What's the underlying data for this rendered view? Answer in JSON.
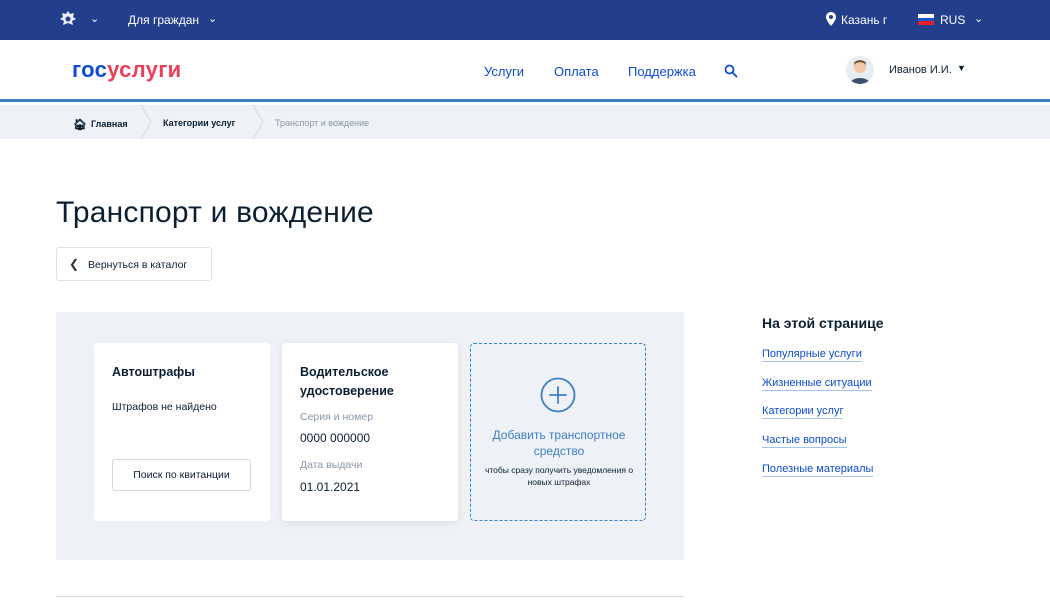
{
  "topbar": {
    "audience_label": "Для граждан",
    "city": "Казань г",
    "language": "RUS",
    "colors": {
      "background": "#233f8c",
      "text": "#ffffff"
    },
    "icons": [
      "emblem-icon",
      "chevron-down-icon",
      "location-pin-icon",
      "flag-ru-icon"
    ]
  },
  "header": {
    "logo_part1": "гос",
    "logo_part2": "услуги",
    "nav": [
      {
        "label": "Услуги"
      },
      {
        "label": "Оплата"
      },
      {
        "label": "Поддержка"
      }
    ],
    "user_name": "Иванов И.И.",
    "colors": {
      "logo_blue": "#0d4cd3",
      "logo_red": "#ee3f58",
      "underline": "#3e7ec4"
    }
  },
  "breadcrumbs": {
    "home": "Главная",
    "category": "Категории услуг",
    "current": "Транспорт и вождение"
  },
  "page": {
    "title": "Транспорт и вождение",
    "back_label": "Вернуться в каталог"
  },
  "cards": {
    "fines": {
      "title": "Автоштрафы",
      "status": "Штрафов не найдено",
      "button": "Поиск по квитанции"
    },
    "license": {
      "title": "Водительское удостоверение",
      "number_label": "Серия и номер",
      "number_value": "0000 000000",
      "issue_label": "Дата выдачи",
      "issue_value": "01.01.2021"
    },
    "add_vehicle": {
      "title": "Добавить транспортное средство",
      "subtitle": "чтобы сразу получить уведомления о новых штрафах"
    }
  },
  "sidebar": {
    "title": "На этой странице",
    "links": [
      {
        "label": "Популярные услуги"
      },
      {
        "label": "Жизненные ситуации"
      },
      {
        "label": "Категории услуг"
      },
      {
        "label": "Частые вопросы"
      },
      {
        "label": "Полезные материалы"
      }
    ]
  }
}
